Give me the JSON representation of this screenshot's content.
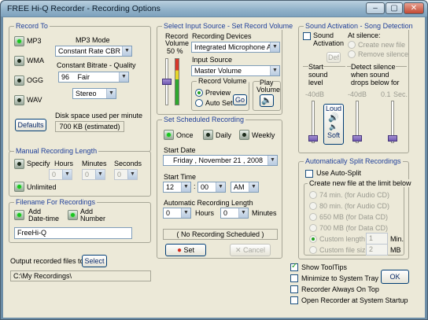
{
  "window": {
    "title": "FREE Hi-Q Recorder - Recording Options",
    "minimize": "–",
    "maximize": "▢",
    "close": "✕"
  },
  "record_to": {
    "title": "Record To",
    "formats": [
      {
        "label": "MP3",
        "selected": true
      },
      {
        "label": "WMA",
        "selected": false
      },
      {
        "label": "OGG",
        "selected": false
      },
      {
        "label": "WAV",
        "selected": false
      }
    ],
    "mp3_mode_label": "MP3 Mode",
    "mp3_mode_value": "Constant Rate CBR",
    "bitrate_label": "Constant Bitrate - Quality",
    "bitrate_num": "96",
    "bitrate_quality": "Fair",
    "channels_value": "Stereo",
    "defaults_button": "Defaults",
    "disk_space_label": "Disk space used per minute",
    "disk_space_value": "700  KB (estimated)"
  },
  "input_source": {
    "title": "Select Input Source - Set Record Volume",
    "record_volume_label": "Record\nVolume",
    "record_volume_label_1": "Record",
    "record_volume_label_2": "Volume",
    "record_volume_pct": "50 %",
    "record_volume_level": 0.5,
    "devices_label": "Recording Devices",
    "device_value": "Integrated Microphone Array",
    "input_source_label": "Input Source",
    "input_source_value": "Master Volume",
    "record_volume_box_label": "Record Volume",
    "preview_label": "Preview",
    "autoset_label": "Auto Set",
    "go_button": "Go",
    "play_volume_label": "Play\nVolume",
    "play_volume_1": "Play",
    "play_volume_2": "Volume"
  },
  "sound_activation": {
    "title": "Sound Activation - Song Detection",
    "activation_label_1": "Sound",
    "activation_label_2": "Activation",
    "def_button": "Def",
    "at_silence_label": "At silence:",
    "create_new_file": "Create new file",
    "remove_silence": "Remove silence",
    "start_sound_1": "Start",
    "start_sound_2": "sound",
    "start_sound_3": "level",
    "start_db": "-40dB",
    "detect_silence_label": "Detect silence",
    "when_sound_1": "when sound",
    "when_sound_2": "drops below",
    "for_label": "for",
    "detect_db": "-40dB",
    "seconds_value": "0.1",
    "seconds_unit": "Sec.",
    "loud_label": "Loud",
    "soft_label": "Soft"
  },
  "manual_length": {
    "title": "Manual Recording Length",
    "specify_label": "Specify",
    "hours_label": "Hours",
    "minutes_label": "Minutes",
    "seconds_label": "Seconds",
    "hours_value": "0",
    "minutes_value": "0",
    "seconds_value": "0",
    "unlimited_label": "Unlimited"
  },
  "filename": {
    "title": "Filename For Recordings",
    "add_datetime_1": "Add",
    "add_datetime_2": "Date-time",
    "add_number_1": "Add",
    "add_number_2": "Number",
    "name_value": "FreeHi-Q"
  },
  "output": {
    "label": "Output recorded files to",
    "select_button": "Select",
    "path_value": "C:\\My Recordings\\"
  },
  "scheduled": {
    "title": "Set Scheduled Recording",
    "once": "Once",
    "daily": "Daily",
    "weekly": "Weekly",
    "start_date_label": "Start Date",
    "date_value": "Friday      ,  November  21 , 2008",
    "start_time_label": "Start Time",
    "hour_value": "12",
    "colon": ":",
    "minute_value": "00",
    "ampm_value": "AM",
    "auto_length_label": "Automatic Recording Length",
    "auto_hours_value": "0",
    "hours_label": "Hours",
    "auto_minutes_value": "0",
    "minutes_label": "Minutes",
    "status": "( No Recording Scheduled )",
    "set_button": "Set",
    "cancel_button": "Cancel"
  },
  "auto_split": {
    "title": "Automatically Split Recordings",
    "use_label": "Use Auto-Split",
    "create_label": "Create new file at the limit below",
    "options": [
      "74 min. (for Audio CD)",
      "80 min. (for Audio CD)",
      "650 MB (for Data CD)",
      "700 MB (for Data CD)"
    ],
    "custom_length_label": "Custom length",
    "custom_length_value": "1",
    "custom_length_unit": "Min.",
    "custom_size_label": "Custom file size",
    "custom_size_value": "2",
    "custom_size_unit": "MB"
  },
  "options": {
    "show_tooltips": "Show ToolTips",
    "minimize_tray": "Minimize to System Tray",
    "always_on_top": "Recorder Always On Top",
    "open_at_startup": "Open Recorder at System Startup",
    "ok_button": "OK"
  }
}
